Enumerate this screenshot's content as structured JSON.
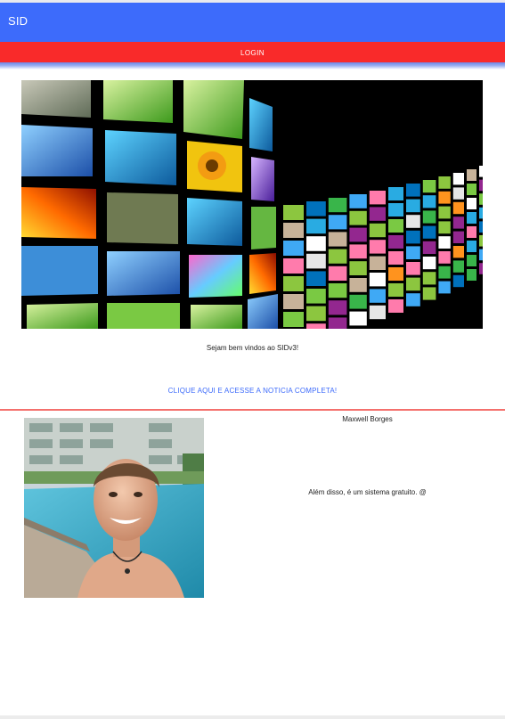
{
  "header": {
    "title": "SID"
  },
  "nav": {
    "login_label": "LOGIN"
  },
  "main": {
    "hero_image": "video-wall-monitors-image",
    "welcome_text": "Sejam bem vindos ao SIDv3!",
    "news_link_label": "CLIQUE AQUI E ACESSE A NOTICIA COMPLETA!"
  },
  "profile": {
    "photo": "profile-photo-poolside",
    "name": "Maxwell Borges",
    "description": "Além disso, é um sistema gratuito. @"
  },
  "colors": {
    "header_bg": "#3d6bfb",
    "nav_bg": "#f92a2a",
    "link": "#3d6bfb",
    "divider": "#f4706d"
  }
}
